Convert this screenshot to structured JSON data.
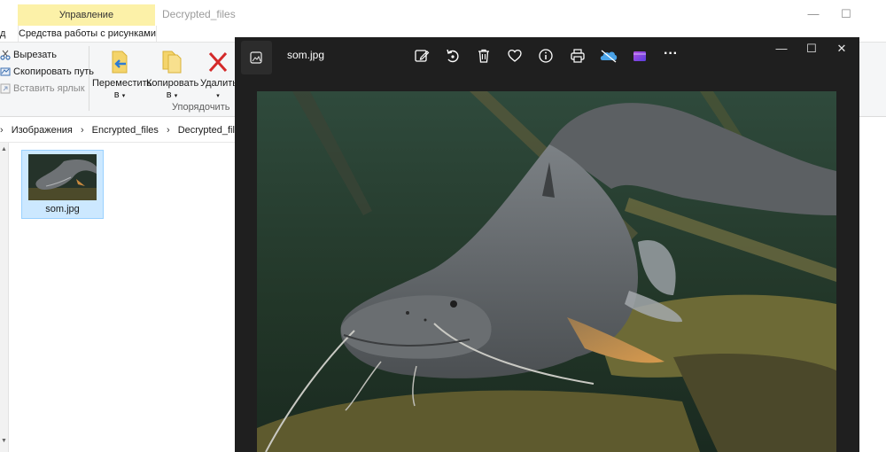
{
  "explorer": {
    "ribbon_tab_contextual": "Управление",
    "ribbon_tab_active": "Средства работы с рисунками",
    "ribbon_tab_left_fragment": "д",
    "window_title": "Decrypted_files",
    "clipboard": {
      "cut": "Вырезать",
      "copy_path": "Скопировать путь",
      "paste_shortcut": "Вставить ярлык"
    },
    "organize": {
      "move_to_line1": "Переместить",
      "move_to_line2": "в",
      "copy_to_line1": "Копировать",
      "copy_to_line2": "в",
      "delete_label": "Удалить",
      "group_label": "Упорядочить"
    },
    "breadcrumb": [
      "Изображения",
      "Encrypted_files",
      "Decrypted_files"
    ],
    "files": [
      {
        "name": "som.jpg"
      }
    ],
    "colors": {
      "contextual_tab": "#fcf1a8",
      "selection": "#cce8ff",
      "delete_red": "#d42a2a"
    }
  },
  "viewer": {
    "title": "som.jpg",
    "toolbar_icons": [
      "edit-icon",
      "rotate-icon",
      "delete-icon",
      "favorite-icon",
      "info-icon",
      "print-icon",
      "onedrive-icon",
      "video-editor-icon",
      "more-icon"
    ],
    "more_label": "···",
    "window_controls": {
      "minimize": "—",
      "maximize": "☐",
      "close": "✕"
    },
    "colors": {
      "background": "#1f1f1f",
      "onedrive": "#4aa3e8",
      "video_editor": "#7b3fe4"
    }
  },
  "explorer_controls": {
    "minimize": "—",
    "maximize": "☐"
  }
}
